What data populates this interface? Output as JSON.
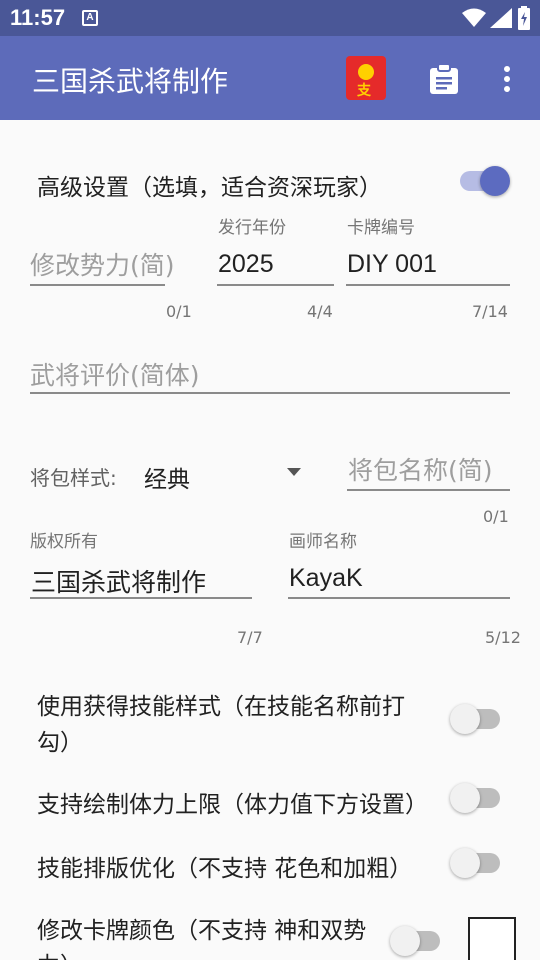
{
  "status": {
    "time": "11:57",
    "a_icon": "A"
  },
  "appbar": {
    "title": "三国杀武将制作",
    "redpacket_label": "支"
  },
  "advanced": {
    "label": "高级设置（选填，适合资深玩家）",
    "enabled": true
  },
  "fields": {
    "faction": {
      "placeholder": "修改势力(简)",
      "value": "",
      "counter": "0/1"
    },
    "year": {
      "label": "发行年份",
      "value": "2025",
      "counter": "4/4"
    },
    "card_no": {
      "label": "卡牌编号",
      "value": "DIY 001",
      "counter": "7/14"
    },
    "evaluation": {
      "placeholder": "武将评价(简体)",
      "value": ""
    },
    "pack_style": {
      "label": "将包样式:",
      "value": "经典"
    },
    "pack_name": {
      "placeholder": "将包名称(简)",
      "value": "",
      "counter": "0/1"
    },
    "copyright": {
      "label": "版权所有",
      "value": "三国杀武将制作",
      "counter": "7/7"
    },
    "artist": {
      "label": "画师名称",
      "value": "KayaK",
      "counter": "5/12"
    }
  },
  "options": {
    "skill_style": {
      "label_line1": "使用获得技能样式（在技能名称前打",
      "label_line2": "勾）",
      "enabled": false
    },
    "hp_limit": {
      "label": "支持绘制体力上限（体力值下方设置）",
      "enabled": false
    },
    "skill_layout": {
      "label": "技能排版优化（不支持 花色和加粗）",
      "enabled": false
    },
    "card_color": {
      "label_line1": "修改卡牌颜色（不支持 神和双势",
      "label_line2": "力）",
      "enabled": false,
      "color": "#ffffff"
    }
  }
}
